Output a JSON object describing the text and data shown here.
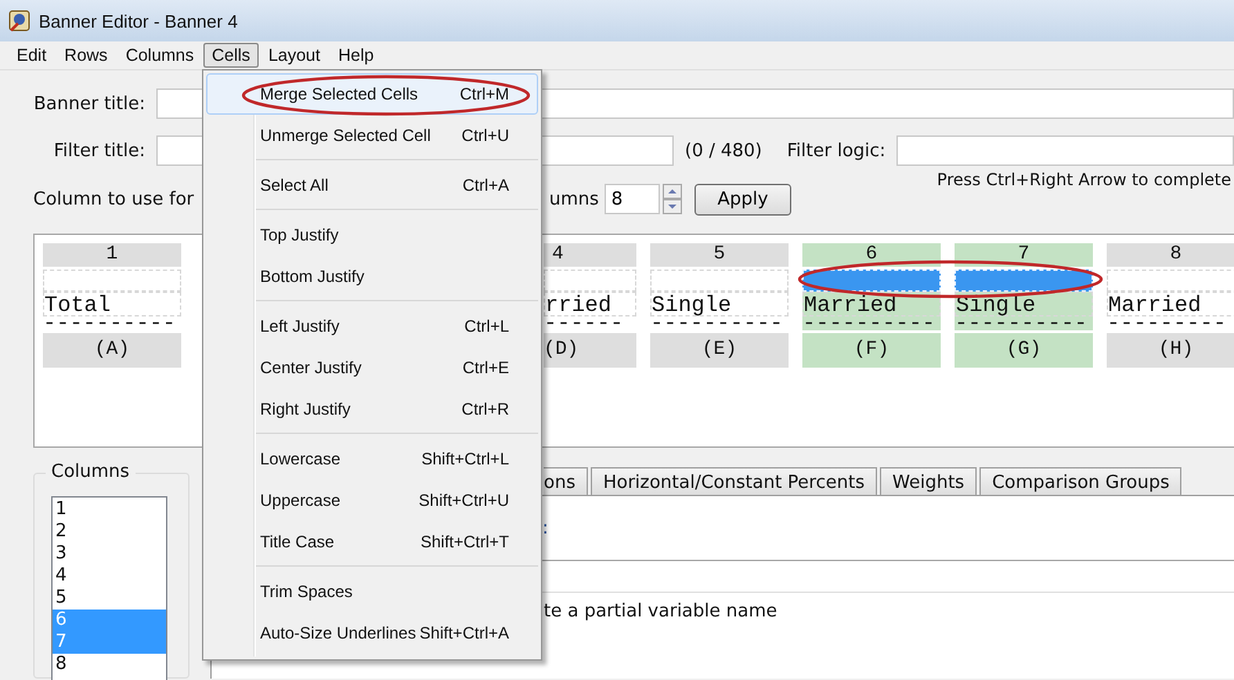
{
  "window": {
    "title": "Banner Editor - Banner 4"
  },
  "menu_bar": [
    {
      "label": "Edit",
      "selected": false
    },
    {
      "label": "Rows",
      "selected": false
    },
    {
      "label": "Columns",
      "selected": false
    },
    {
      "label": "Cells",
      "selected": true
    },
    {
      "label": "Layout",
      "selected": false
    },
    {
      "label": "Help",
      "selected": false
    }
  ],
  "form": {
    "banner_title": {
      "label": "Banner title:"
    },
    "filter_title": {
      "label": "Filter title:",
      "count": "(0 / 480)"
    },
    "filter_logic": {
      "label": "Filter logic:",
      "hint": "Press Ctrl+Right Arrow to complete"
    },
    "column_to_use": {
      "label": "Column to use for"
    },
    "columns_count": {
      "label": "umns",
      "value": "8"
    },
    "apply_button": "Apply"
  },
  "banner": {
    "circled_selection": true,
    "columns": [
      {
        "kind": "full",
        "number": "1",
        "label": "Total",
        "underline": "----------",
        "letter": "(A)",
        "selected": false
      },
      {
        "kind": "clipped",
        "number": "4",
        "label": "rried",
        "underline": "------",
        "letter": "(D)",
        "selected": false
      },
      {
        "kind": "full",
        "number": "5",
        "label": "Single",
        "underline": "----------",
        "letter": "(E)",
        "selected": false
      },
      {
        "kind": "full",
        "number": "6",
        "label": "Married",
        "underline": "----------",
        "letter": "(F)",
        "selected": true
      },
      {
        "kind": "full",
        "number": "7",
        "label": "Single",
        "underline": "----------",
        "letter": "(G)",
        "selected": true
      },
      {
        "kind": "full",
        "number": "8",
        "label": "Married",
        "underline": "---------",
        "letter": "(H)",
        "selected": false
      }
    ]
  },
  "columns_list": {
    "title": "Columns",
    "items": [
      {
        "label": "1",
        "selected": false
      },
      {
        "label": "2",
        "selected": false
      },
      {
        "label": "3",
        "selected": false
      },
      {
        "label": "4",
        "selected": false
      },
      {
        "label": "5",
        "selected": false
      },
      {
        "label": "6",
        "selected": true
      },
      {
        "label": "7",
        "selected": true
      },
      {
        "label": "8",
        "selected": false
      }
    ]
  },
  "tabs": [
    {
      "label": "ons"
    },
    {
      "label": "Horizontal/Constant Percents"
    },
    {
      "label": "Weights"
    },
    {
      "label": "Comparison Groups"
    }
  ],
  "tab_panel": {
    "field_label": ":",
    "hint": "te a partial variable name"
  },
  "cells_menu": {
    "items": [
      {
        "kind": "item",
        "label": "Merge Selected Cells",
        "shortcut": "Ctrl+M",
        "selected": true,
        "circled": true
      },
      {
        "kind": "item",
        "label": "Unmerge Selected Cell",
        "shortcut": "Ctrl+U",
        "selected": false,
        "circled": false
      },
      {
        "kind": "separator"
      },
      {
        "kind": "item",
        "label": "Select All",
        "shortcut": "Ctrl+A",
        "selected": false,
        "circled": false
      },
      {
        "kind": "separator"
      },
      {
        "kind": "item",
        "label": "Top Justify",
        "selected": false,
        "circled": false
      },
      {
        "kind": "item",
        "label": "Bottom Justify",
        "selected": false,
        "circled": false
      },
      {
        "kind": "separator"
      },
      {
        "kind": "item",
        "label": "Left Justify",
        "shortcut": "Ctrl+L",
        "selected": false,
        "circled": false
      },
      {
        "kind": "item",
        "label": "Center Justify",
        "shortcut": "Ctrl+E",
        "selected": false,
        "circled": false
      },
      {
        "kind": "item",
        "label": "Right Justify",
        "shortcut": "Ctrl+R",
        "selected": false,
        "circled": false
      },
      {
        "kind": "separator"
      },
      {
        "kind": "item",
        "label": "Lowercase",
        "shortcut": "Shift+Ctrl+L",
        "selected": false,
        "circled": false
      },
      {
        "kind": "item",
        "label": "Uppercase",
        "shortcut": "Shift+Ctrl+U",
        "selected": false,
        "circled": false
      },
      {
        "kind": "item",
        "label": "Title Case",
        "shortcut": "Shift+Ctrl+T",
        "selected": false,
        "circled": false
      },
      {
        "kind": "separator"
      },
      {
        "kind": "item",
        "label": "Trim Spaces",
        "selected": false,
        "circled": false
      },
      {
        "kind": "item",
        "label": "Auto-Size Underlines",
        "shortcut": "Shift+Ctrl+A",
        "selected": false,
        "circled": false
      }
    ]
  }
}
